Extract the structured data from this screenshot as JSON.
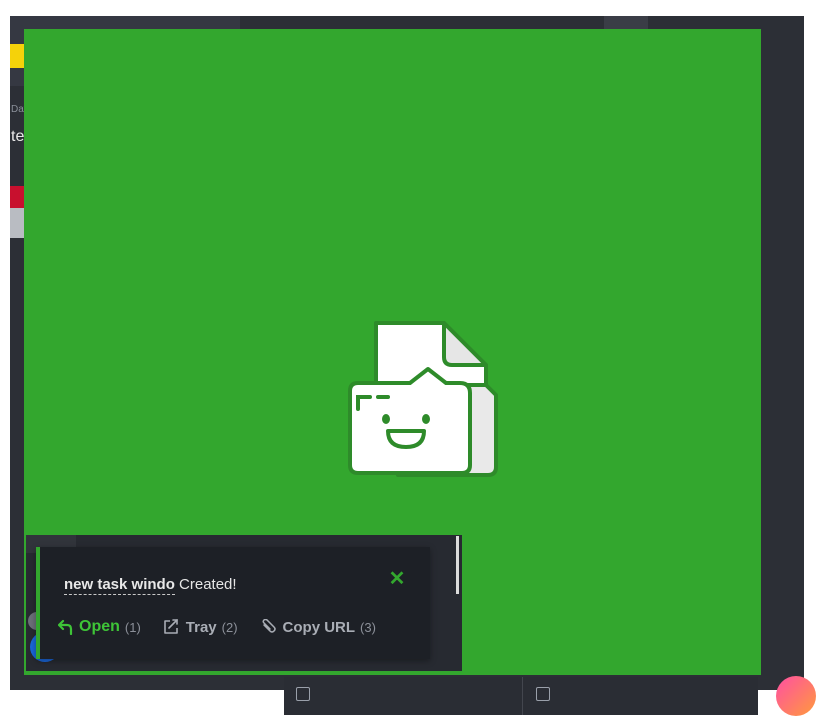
{
  "toast": {
    "task_name": "new task windo",
    "status_text": "Created!",
    "actions": [
      {
        "label": "Open",
        "shortcut": "(1)",
        "icon": "reply-arrow-icon"
      },
      {
        "label": "Tray",
        "shortcut": "(2)",
        "icon": "tray-icon"
      },
      {
        "label": "Copy URL",
        "shortcut": "(3)",
        "icon": "paperclip-icon"
      }
    ],
    "close_icon": "close-icon"
  },
  "background": {
    "label_small": "Dat",
    "label_big": "te"
  },
  "colors": {
    "overlay_green": "#33a72e",
    "toast_bg": "#1d2026",
    "action_open": "#3ec437",
    "action_muted": "#a9adb5"
  }
}
